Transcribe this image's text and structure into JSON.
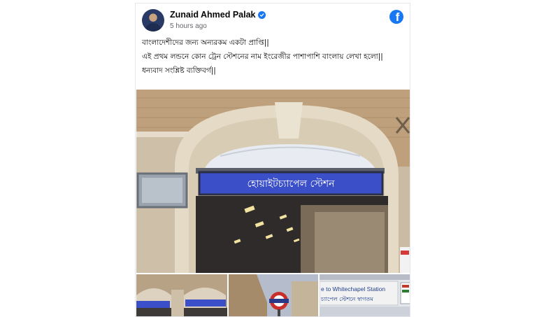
{
  "post": {
    "author": "Zunaid Ahmed Palak",
    "verified_icon": "verified-badge-icon",
    "timestamp": "5 hours ago",
    "platform_icon": "facebook-logo-icon",
    "platform_letter": "f",
    "text": [
      "বাংলাদেশীদের জন্য অন্যরকম একটা প্রাপ্তি||",
      "এই প্রথম লন্ডনে কোন ট্রেন স্টেশনের নাম ইংরেজীর পাশাপাশি বাংলায় লেখা হলো||",
      "ধন্যবাদ সংশ্লিষ্ট ব্যক্তিবর্গ||"
    ]
  },
  "photos": {
    "main_sign_text": "হোয়াইটচ্যাপেল স্টেশন",
    "thumb3_line1": "e to Whitechapel Station",
    "thumb3_line2": "চ্যাপেল স্টেশনে স্বাগতম"
  },
  "colors": {
    "brand": "#1877f2",
    "sign_blue": "#3b4fc8",
    "text": "#050505",
    "muted": "#65676b"
  }
}
